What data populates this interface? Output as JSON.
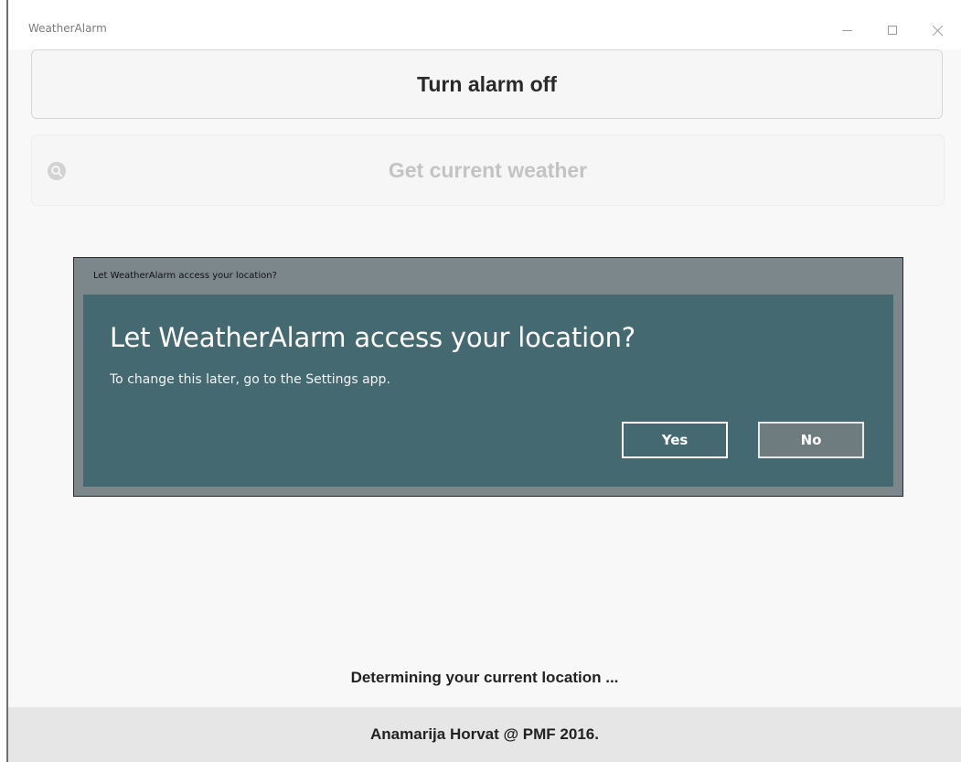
{
  "window": {
    "title": "WeatherAlarm"
  },
  "main": {
    "alarm_button_label": "Turn alarm off",
    "weather_button_label": "Get current weather",
    "status_text": "Determining your current location ..."
  },
  "footer": {
    "text": "Anamarija Horvat @ PMF 2016."
  },
  "dialog": {
    "caption": "Let WeatherAlarm access your location?",
    "title": "Let WeatherAlarm access your location?",
    "message": "To change this later, go to the Settings app.",
    "yes_label": "Yes",
    "no_label": "No"
  },
  "colors": {
    "dialog_body": "#446970",
    "dialog_frame": "#7b878b",
    "footer_bg": "#e6e6e6",
    "content_bg": "#f8f8f8"
  },
  "icons": {
    "weather_button_icon": "search-icon"
  }
}
